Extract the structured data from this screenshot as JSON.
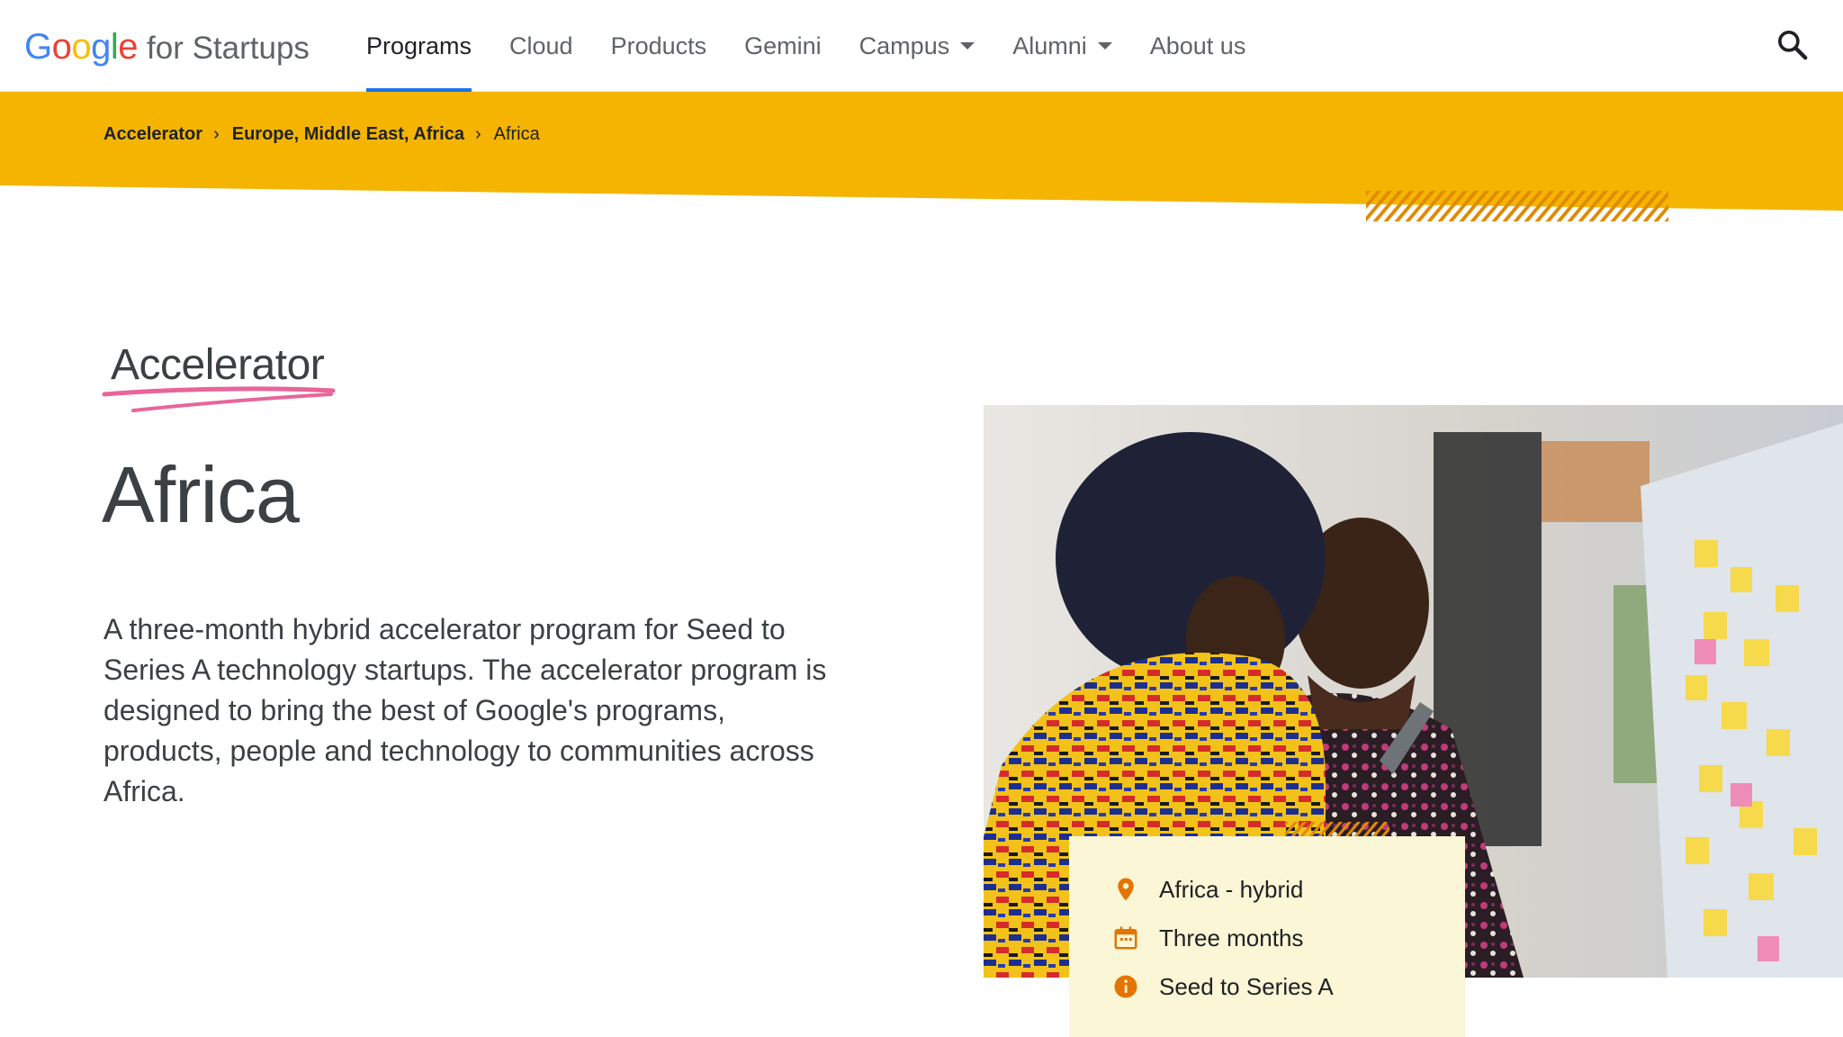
{
  "logo": {
    "word_letters": [
      "G",
      "o",
      "o",
      "g",
      "l",
      "e"
    ],
    "letter_colors": [
      "#4285f4",
      "#ea4335",
      "#fbbc04",
      "#4285f4",
      "#34a853",
      "#ea4335"
    ],
    "suffix": "for Startups"
  },
  "nav": {
    "items": [
      {
        "label": "Programs",
        "active": true
      },
      {
        "label": "Cloud"
      },
      {
        "label": "Products"
      },
      {
        "label": "Gemini"
      },
      {
        "label": "Campus",
        "dropdown": true
      },
      {
        "label": "Alumni",
        "dropdown": true
      },
      {
        "label": "About us"
      }
    ],
    "search_icon": "search-icon"
  },
  "breadcrumb": {
    "items": [
      "Accelerator",
      "Europe, Middle East, Africa",
      "Africa"
    ],
    "separator_icon": "chevron-right-icon"
  },
  "hero": {
    "eyebrow": "Accelerator",
    "title": "Africa",
    "description": "A three-month hybrid accelerator program for Seed to Series A technology startups. The accelerator program is designed to bring the best of Google's programs, products, people and technology to communities across Africa."
  },
  "info_card": {
    "items": [
      {
        "icon": "location-pin-icon",
        "text": "Africa - hybrid"
      },
      {
        "icon": "calendar-icon",
        "text": "Three months"
      },
      {
        "icon": "info-icon",
        "text": "Seed to Series A"
      }
    ]
  },
  "colors": {
    "band_yellow": "#f4b400",
    "accent_orange": "#e37400",
    "nav_active_underline": "#1a73e8",
    "eyebrow_underline": "#e8659a",
    "card_bg": "#fbf6d6"
  }
}
